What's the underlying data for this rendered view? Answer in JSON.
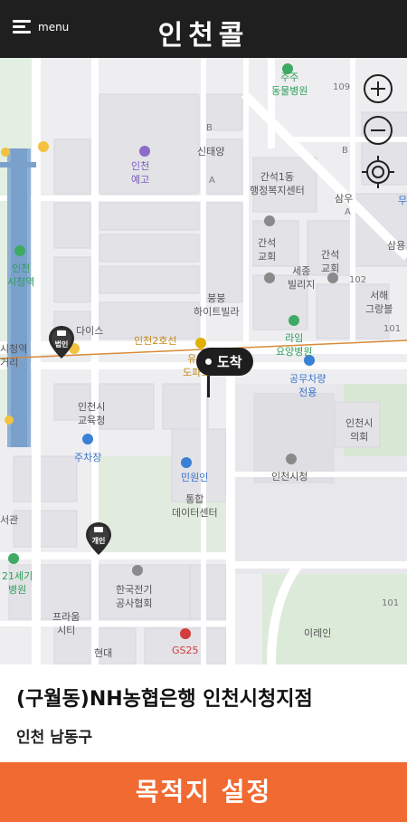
{
  "header": {
    "menu_label": "menu",
    "title": "인천콜"
  },
  "map": {
    "labels": {
      "zoo": "주주\n동물병원",
      "num109": "109",
      "incheon_art": "인천\n예고",
      "sintaeyang": "신태양",
      "b1": "B",
      "a1": "A",
      "b2": "B",
      "ganseok_center": "간석1동\n행정복지센터",
      "samu": "삼우",
      "a2": "A",
      "mu": "무",
      "ganseok_church1": "간석\n교회",
      "ganseok_church2": "간석\n교회",
      "samyong": "삼용",
      "sejong": "세종\n빌리지",
      "num102": "102",
      "seohae": "서해\n그랑블",
      "city_hall_stn": "인천\n시청역",
      "bungbung": "붕붕\n하이트빌라",
      "num101a": "101",
      "raim": "라임\n요양병원",
      "city_hall_stn2": "시청역",
      "street": "거리",
      "dimis": "다이스",
      "line2": "인천2호선",
      "yuki": "유키\n도파스",
      "gongmu": "공무차량\n전용",
      "education": "인천시\n교육청",
      "parking": "주차장",
      "city_council": "인천시\n의회",
      "minwon": "민원인",
      "city_hall": "인천시청",
      "data_center": "통합\n데이터센터",
      "seogwan": "서관",
      "hospital21": "21세기\n병원",
      "kepa": "한국전기\n공사협회",
      "num101b": "101",
      "prauge": "프라움\n시티",
      "irein": "이레인",
      "gs25": "GS25",
      "hyundai": "현대"
    },
    "markers": {
      "destination": "도착",
      "corporate_taxi": "법인",
      "private_taxi": "개인"
    },
    "controls": [
      "zoom-in",
      "zoom-out",
      "locate"
    ]
  },
  "place": {
    "name": "(구월동)NH농협은행 인천시청지점",
    "address": "인천 남동구"
  },
  "cta": {
    "label": "목적지 설정"
  },
  "colors": {
    "header": "#1f1f1f",
    "accent": "#f06a32",
    "rail": "#7aa0cc",
    "subway": "#d98a3a"
  }
}
